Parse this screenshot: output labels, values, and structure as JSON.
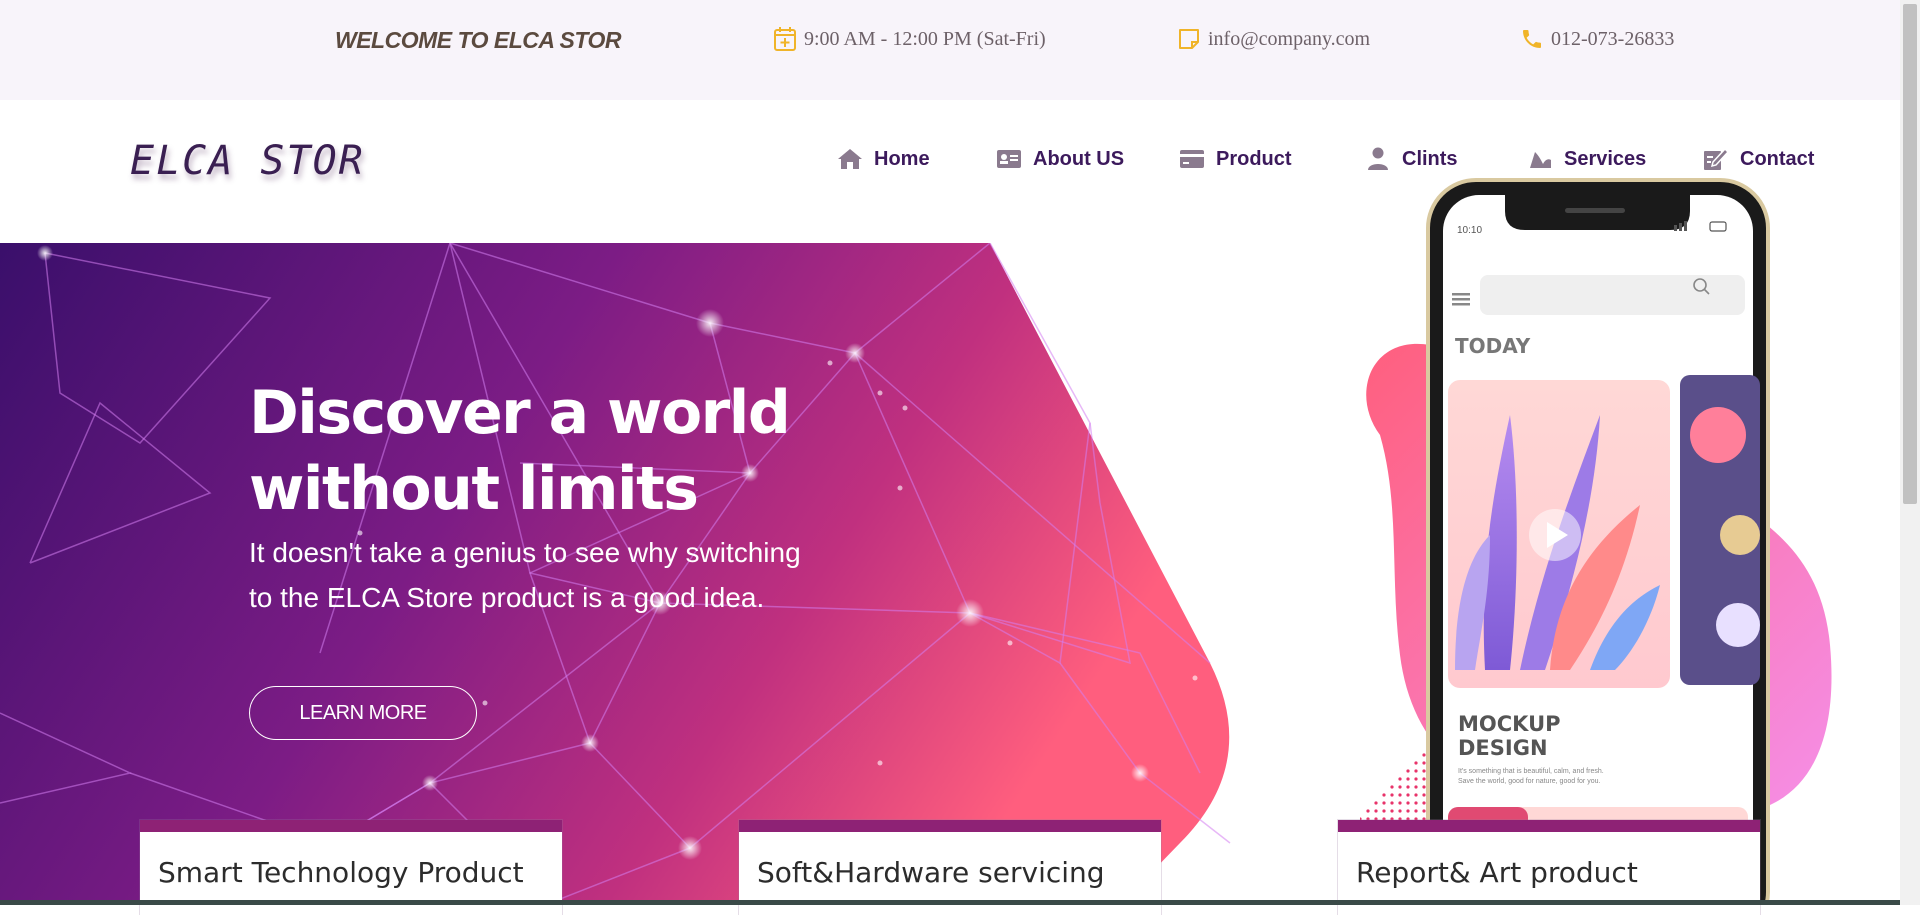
{
  "topbar": {
    "welcome": "WELCOME TO ELCA STOR",
    "hours": "9:00 AM - 12:00 PM (Sat-Fri)",
    "email": "info@company.com",
    "phone": "012-073-26833"
  },
  "brand": {
    "logo": "ELCA STOR"
  },
  "nav": {
    "items": [
      {
        "label": "Home",
        "icon": "home-icon"
      },
      {
        "label": "About US",
        "icon": "id-card-icon"
      },
      {
        "label": "Product",
        "icon": "credit-card-icon"
      },
      {
        "label": "Clints",
        "icon": "user-icon"
      },
      {
        "label": "Services",
        "icon": "wave-icon"
      },
      {
        "label": "Contact",
        "icon": "edit-icon"
      }
    ]
  },
  "hero": {
    "title_line1": "Discover a world",
    "title_line2": "without limits",
    "subtitle": "It doesn't take a genius to see why switching to the ELCA Store product is a good idea.",
    "button": "LEARN MORE"
  },
  "phone": {
    "time": "10:10",
    "section": "TODAY",
    "mockup_title_1": "MOCKUP",
    "mockup_title_2": "DESIGN",
    "mockup_caption_1": "It's something that is beautiful, calm, and fresh.",
    "mockup_caption_2": "Save the world, good for nature, good for you."
  },
  "cards": [
    {
      "title": "Smart Technology Product"
    },
    {
      "title": "Soft&Hardware servicing"
    },
    {
      "title": "Report& Art product"
    }
  ],
  "colors": {
    "accent": "#8e2275",
    "nav_text": "#3c1a5c",
    "icon_gold": "#f0b429",
    "hero_start": "#3a0f6b",
    "hero_end": "#ff5e7e"
  }
}
